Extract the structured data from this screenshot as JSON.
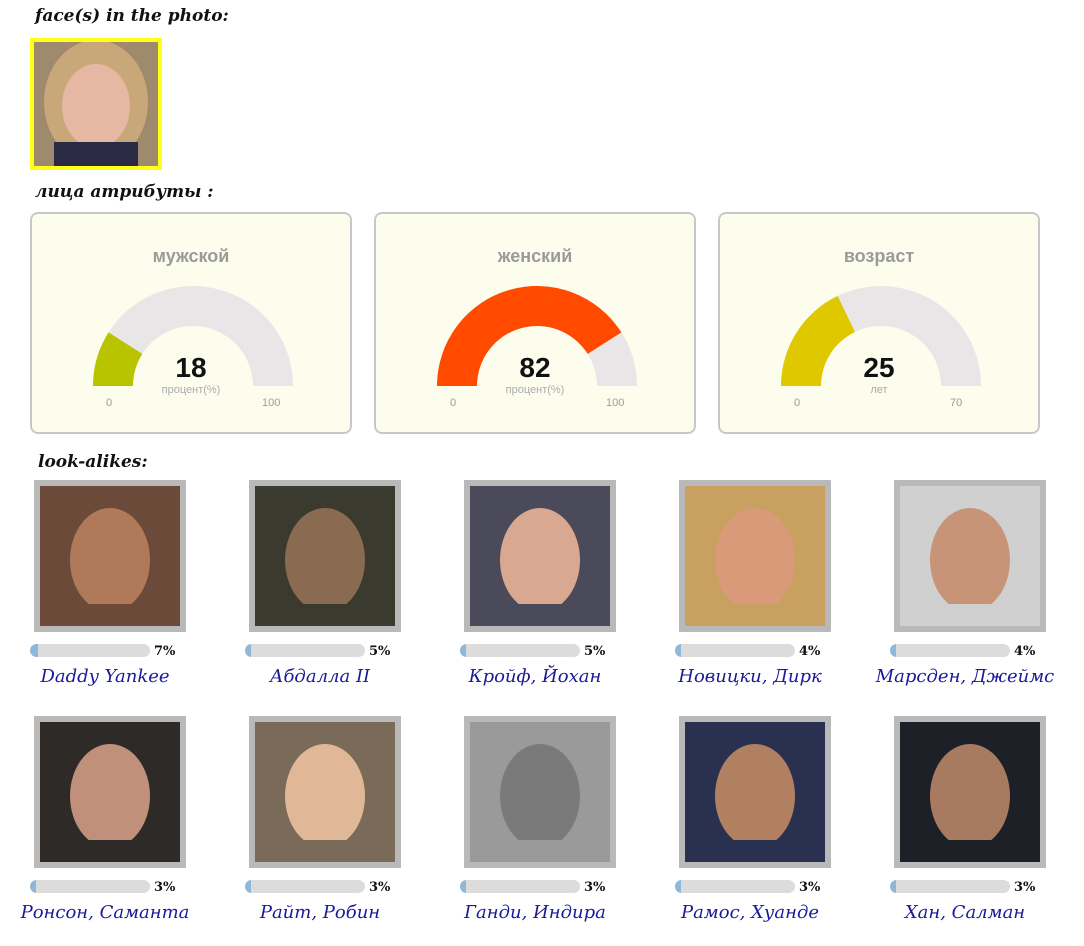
{
  "faces_section": {
    "title": "face(s) in the photo:"
  },
  "attributes_section": {
    "title": "лица атрибуты :"
  },
  "gauges": [
    {
      "title": "мужской",
      "value": "18",
      "unit": "процент(%)",
      "min": "0",
      "max": "100",
      "fraction": 0.18,
      "color": "#b8c400"
    },
    {
      "title": "женский",
      "value": "82",
      "unit": "процент(%)",
      "min": "0",
      "max": "100",
      "fraction": 0.82,
      "color": "#ff4a00"
    },
    {
      "title": "возраст",
      "value": "25",
      "unit": "лет",
      "min": "0",
      "max": "70",
      "fraction": 0.357,
      "color": "#e0c800"
    }
  ],
  "lookalikes_section": {
    "title": "look-alikes:"
  },
  "lookalikes": [
    {
      "name": "Daddy Yankee",
      "percent": "7%",
      "fraction": 0.07
    },
    {
      "name": "Абдалла II",
      "percent": "5%",
      "fraction": 0.05
    },
    {
      "name": "Кройф, Йохан",
      "percent": "5%",
      "fraction": 0.05
    },
    {
      "name": "Новицки, Дирк",
      "percent": "4%",
      "fraction": 0.04
    },
    {
      "name": "Марсден, Джеймс",
      "percent": "4%",
      "fraction": 0.04
    },
    {
      "name": "Ронсон, Саманта",
      "percent": "3%",
      "fraction": 0.03
    },
    {
      "name": "Райт, Робин",
      "percent": "3%",
      "fraction": 0.03
    },
    {
      "name": "Ганди, Индира",
      "percent": "3%",
      "fraction": 0.03
    },
    {
      "name": "Рамос, Хуанде",
      "percent": "3%",
      "fraction": 0.03
    },
    {
      "name": "Хан, Салман",
      "percent": "3%",
      "fraction": 0.03
    }
  ],
  "colors": {
    "highlight_border": "#ffff1a",
    "gauge_track": "#e8e6e6",
    "link": "#1a1a99",
    "bar_fill": "#8fb8d8"
  }
}
